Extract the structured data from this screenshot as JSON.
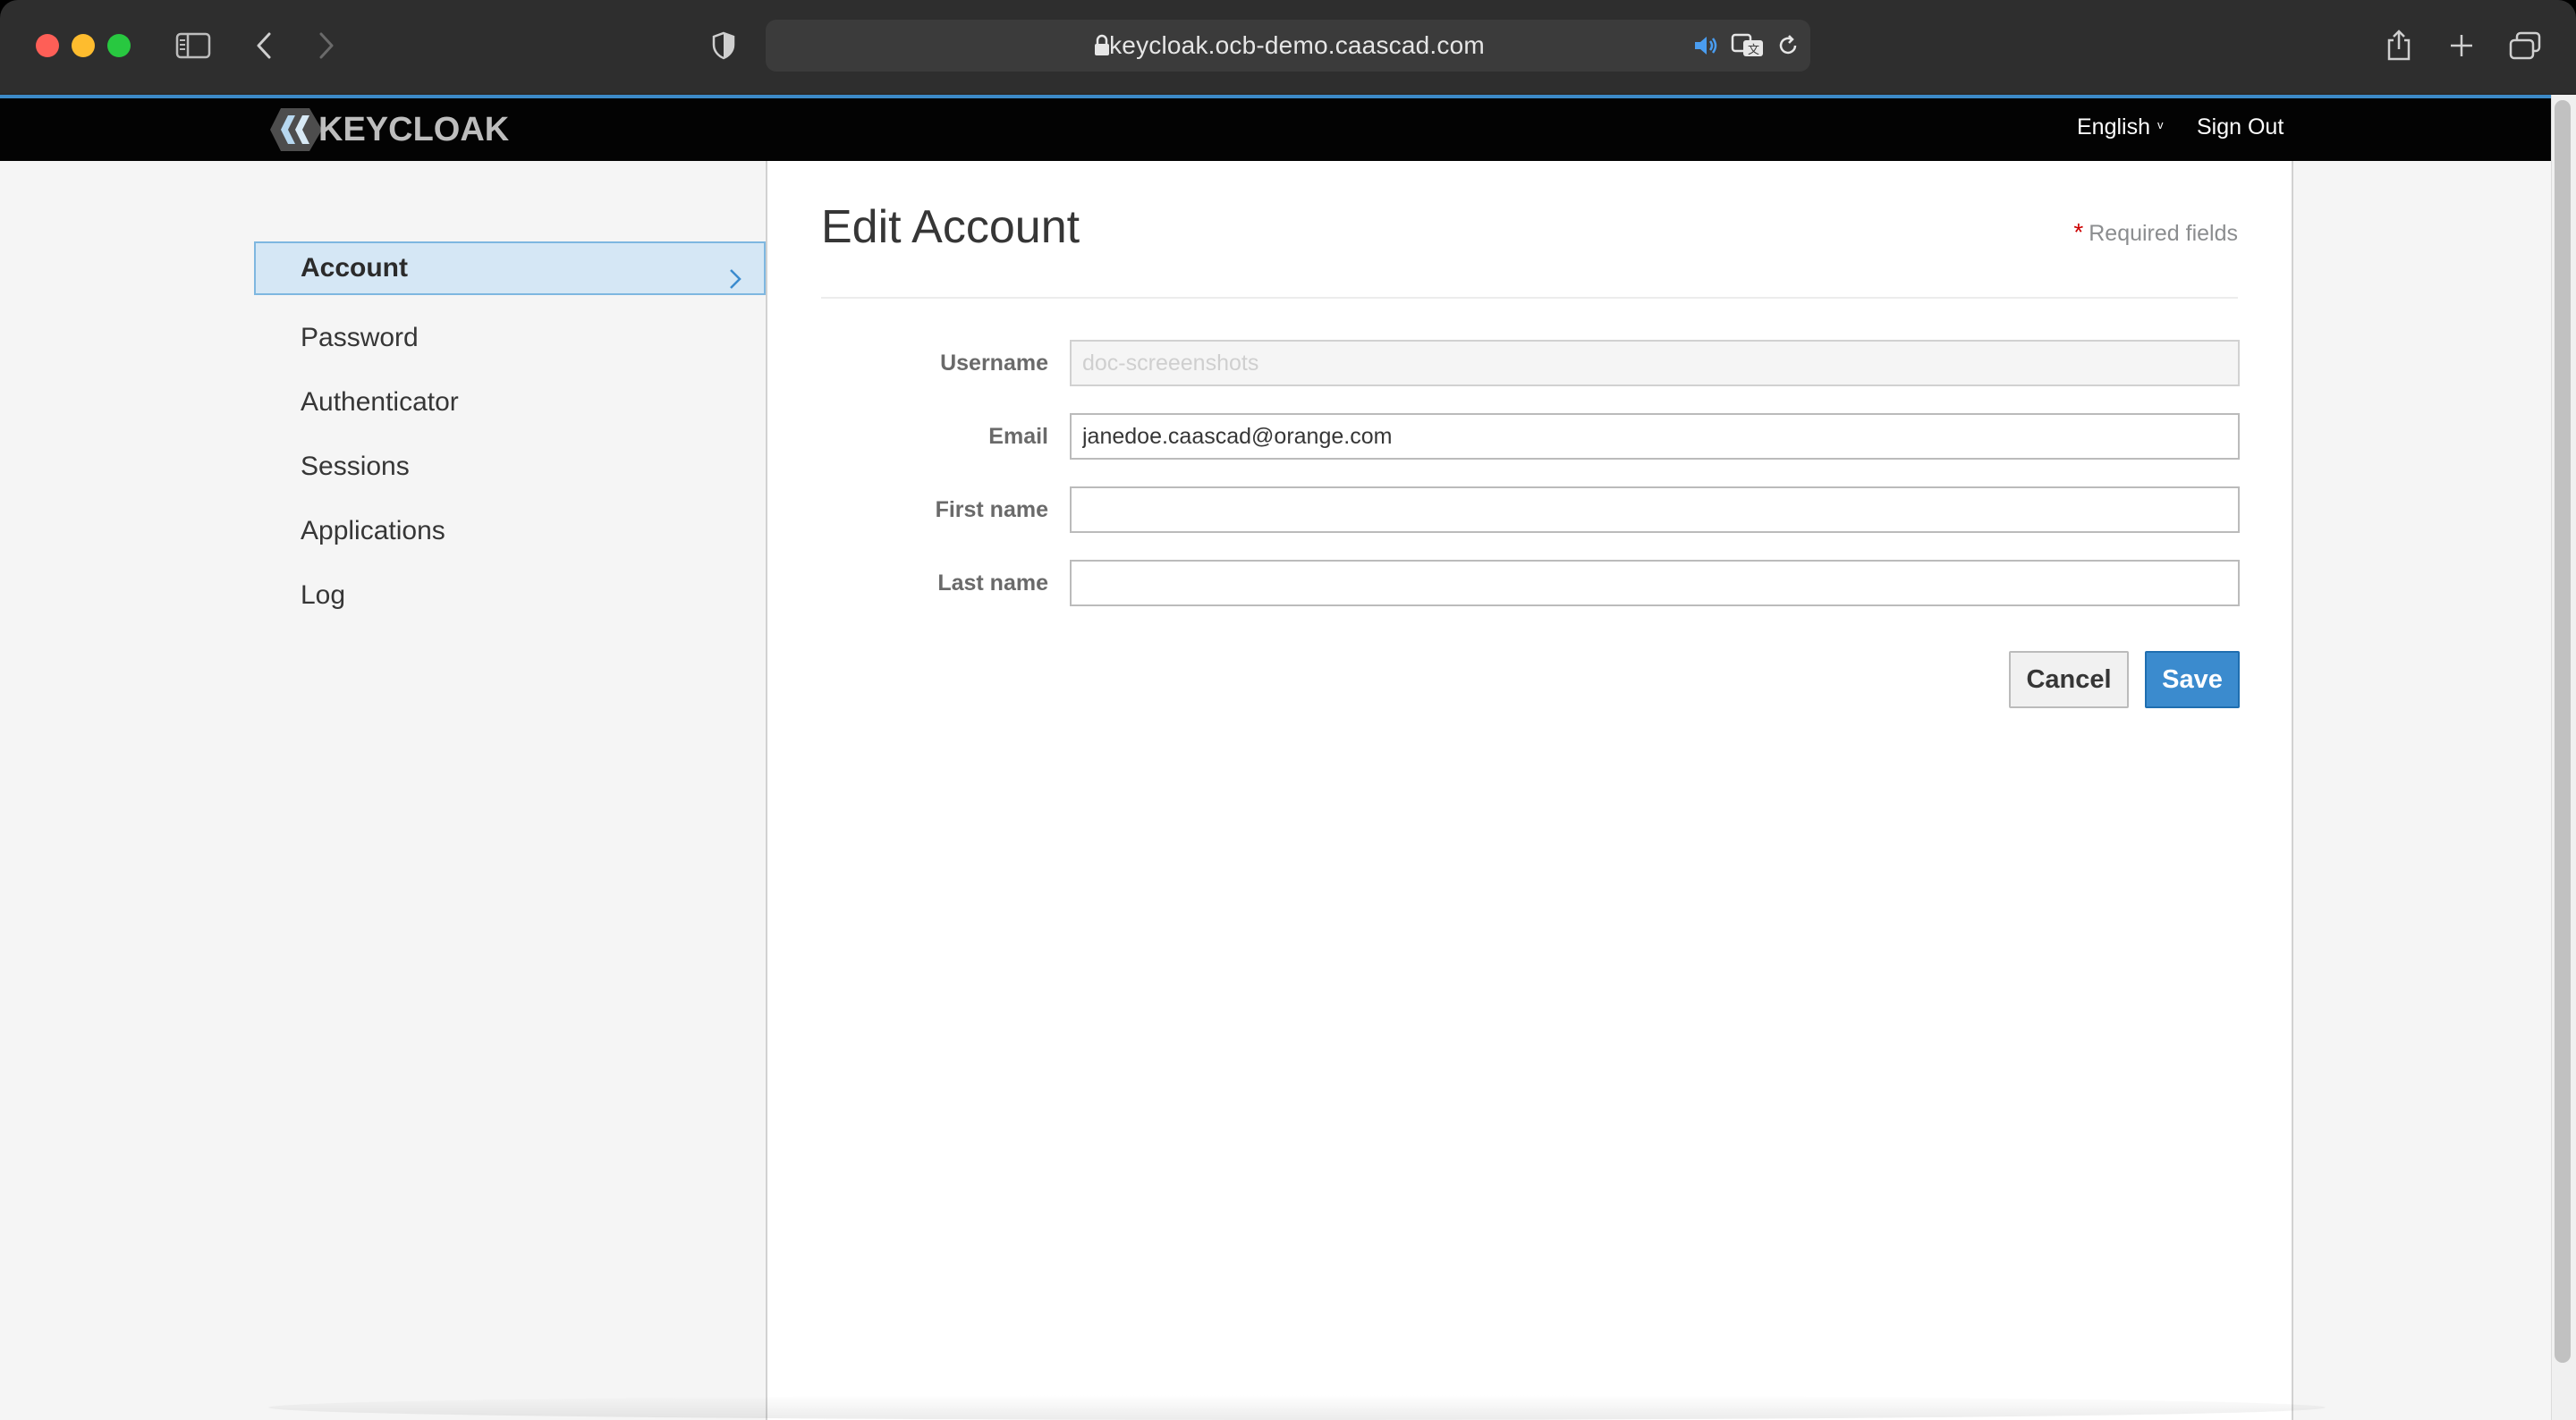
{
  "browser": {
    "url": "keycloak.ocb-demo.caascad.com",
    "icons": [
      "sidebar-toggle-icon",
      "back-icon",
      "forward-icon",
      "shield-icon",
      "lock-icon",
      "speaker-icon",
      "translate-icon",
      "reload-icon",
      "share-icon",
      "new-tab-icon",
      "tabs-overview-icon"
    ]
  },
  "header": {
    "logo_text": "KEYCLOAK",
    "language": "English",
    "sign_out": "Sign Out"
  },
  "sidebar": {
    "items": [
      {
        "label": "Account"
      },
      {
        "label": "Password"
      },
      {
        "label": "Authenticator"
      },
      {
        "label": "Sessions"
      },
      {
        "label": "Applications"
      },
      {
        "label": "Log"
      }
    ]
  },
  "main": {
    "title": "Edit Account",
    "required_star": "*",
    "required_note": "Required fields",
    "fields": {
      "username": {
        "label": "Username",
        "value": "",
        "placeholder": "doc-screeenshots"
      },
      "email": {
        "label": "Email",
        "value": "janedoe.caascad@orange.com",
        "required_star": "*"
      },
      "first_name": {
        "label": "First name",
        "value": "",
        "required_star": "*"
      },
      "last_name": {
        "label": "Last name",
        "value": "",
        "required_star": "*"
      }
    },
    "cancel_label": "Cancel",
    "save_label": "Save"
  },
  "colors": {
    "header_bg": "#030303",
    "accent": "#3b8bce",
    "active_nav_bg": "#d5e7f5",
    "required": "#cc0000"
  }
}
